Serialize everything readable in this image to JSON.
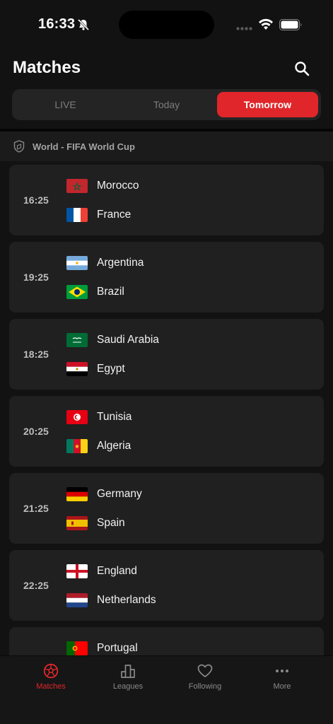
{
  "status_bar": {
    "time": "16:33"
  },
  "header": {
    "title": "Matches",
    "search_icon": "search-icon"
  },
  "tabs": [
    {
      "label": "LIVE",
      "active": false
    },
    {
      "label": "Today",
      "active": false
    },
    {
      "label": "Tomorrow",
      "active": true
    }
  ],
  "league": {
    "name": "World - FIFA World Cup",
    "icon": "shield-icon"
  },
  "matches": [
    {
      "time": "16:25",
      "home": {
        "name": "Morocco",
        "flag": "morocco"
      },
      "away": {
        "name": "France",
        "flag": "france"
      }
    },
    {
      "time": "19:25",
      "home": {
        "name": "Argentina",
        "flag": "argentina"
      },
      "away": {
        "name": "Brazil",
        "flag": "brazil"
      }
    },
    {
      "time": "18:25",
      "home": {
        "name": "Saudi Arabia",
        "flag": "saudi-arabia"
      },
      "away": {
        "name": "Egypt",
        "flag": "egypt"
      }
    },
    {
      "time": "20:25",
      "home": {
        "name": "Tunisia",
        "flag": "tunisia"
      },
      "away": {
        "name": "Algeria",
        "flag": "cameroon-like"
      }
    },
    {
      "time": "21:25",
      "home": {
        "name": "Germany",
        "flag": "germany"
      },
      "away": {
        "name": "Spain",
        "flag": "spain"
      }
    },
    {
      "time": "22:25",
      "home": {
        "name": "England",
        "flag": "england"
      },
      "away": {
        "name": "Netherlands",
        "flag": "netherlands"
      }
    },
    {
      "time": "",
      "home": {
        "name": "Portugal",
        "flag": "portugal"
      },
      "away": {
        "name": "",
        "flag": ""
      }
    }
  ],
  "tab_bar": [
    {
      "label": "Matches",
      "icon": "soccer-ball-icon",
      "active": true
    },
    {
      "label": "Leagues",
      "icon": "podium-icon",
      "active": false
    },
    {
      "label": "Following",
      "icon": "heart-icon",
      "active": false
    },
    {
      "label": "More",
      "icon": "more-dots-icon",
      "active": false
    }
  ],
  "colors": {
    "accent": "#e0262a",
    "background": "#121212",
    "card": "#202020"
  }
}
